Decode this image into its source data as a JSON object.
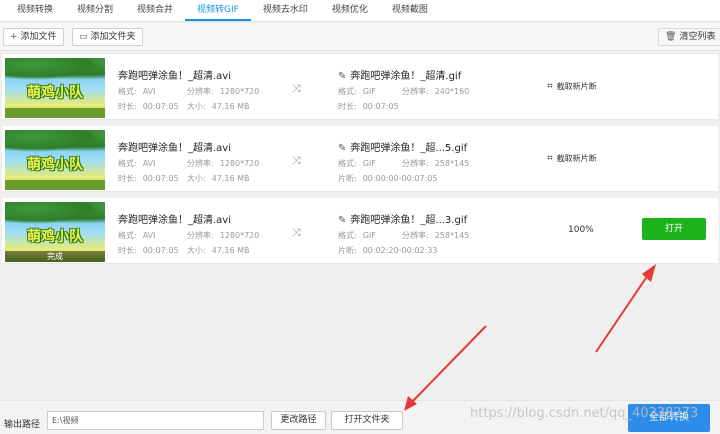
{
  "tabs": [
    "视频转换",
    "视频分割",
    "视频合并",
    "视频转GIF",
    "视频去水印",
    "视频优化",
    "视频截图"
  ],
  "active_tab": "视频转GIF",
  "toolbar": {
    "add_file": "添加文件",
    "add_folder": "添加文件夹",
    "clear_list": "清空列表"
  },
  "labels": {
    "format": "格式:",
    "resolution": "分辨率:",
    "duration": "时长:",
    "size": "大小:",
    "segment": "片断:",
    "crop": "截取新片断",
    "done": "完成",
    "open": "打开"
  },
  "items": [
    {
      "src_name": "奔跑吧弹涂鱼！_超清.avi",
      "src_format": "AVI",
      "src_res": "1280*720",
      "src_duration": "00:07:05",
      "src_size": "47.16 MB",
      "dst_name": "奔跑吧弹涂鱼！_超清.gif",
      "dst_format": "GIF",
      "dst_res": "240*160",
      "dst_label3": "时长:",
      "dst_value3": "00:07:05"
    },
    {
      "src_name": "奔跑吧弹涂鱼！_超清.avi",
      "src_format": "AVI",
      "src_res": "1280*720",
      "src_duration": "00:07:05",
      "src_size": "47.16 MB",
      "dst_name": "奔跑吧弹涂鱼！_超...5.gif",
      "dst_format": "GIF",
      "dst_res": "258*145",
      "dst_label3": "片断:",
      "dst_value3": "00:00:00-00:07:05"
    },
    {
      "src_name": "奔跑吧弹涂鱼！_超清.avi",
      "src_format": "AVI",
      "src_res": "1280*720",
      "src_duration": "00:07:05",
      "src_size": "47.16 MB",
      "dst_name": "奔跑吧弹涂鱼！_超...3.gif",
      "dst_format": "GIF",
      "dst_res": "258*145",
      "dst_label3": "片断:",
      "dst_value3": "00:02:20-00:02:33",
      "progress": "100%"
    }
  ],
  "thumb_text": "萌鸡小队",
  "bottom": {
    "output_label": "输出路径",
    "output_path": "E:\\视频",
    "change_path": "更改路径",
    "open_folder": "打开文件夹",
    "convert_all": "全部转换"
  },
  "watermark": "https://blog.csdn.net/qq_40338273",
  "colors": {
    "accent": "#1a8fe6",
    "open_button": "#1db31d",
    "convert_button": "#2d8ce8",
    "annotation_arrow": "#e53935"
  }
}
